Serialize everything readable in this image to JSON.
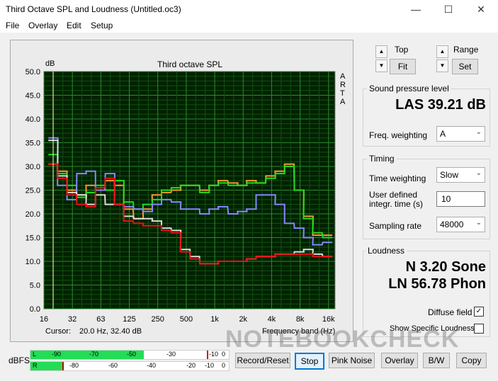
{
  "window": {
    "title": "Third Octave SPL and Loudness (Untitled.oc3)",
    "minimize": "—",
    "maximize": "☐",
    "close": "✕"
  },
  "menu": [
    "File",
    "Overlay",
    "Edit",
    "Setup"
  ],
  "plot": {
    "y_unit": "dB",
    "title": "Third octave SPL",
    "side_label": [
      "A",
      "R",
      "T",
      "A"
    ],
    "y_ticks": [
      "50.0",
      "45.0",
      "40.0",
      "35.0",
      "30.0",
      "25.0",
      "20.0",
      "15.0",
      "10.0",
      "5.0",
      "0.0"
    ],
    "x_ticks": [
      "16",
      "32",
      "63",
      "125",
      "250",
      "500",
      "1k",
      "2k",
      "4k",
      "8k",
      "16k"
    ],
    "cursor_label": "Cursor:",
    "cursor_value": "20.0 Hz, 32.40 dB",
    "x_label": "Frequency band (Hz)"
  },
  "chart_data": {
    "type": "line",
    "title": "Third octave SPL",
    "ylabel": "dB",
    "xlabel": "Frequency band (Hz)",
    "ylim": [
      0,
      50
    ],
    "x_scale": "log",
    "grid": true,
    "x": [
      20,
      25,
      31.5,
      40,
      50,
      63,
      80,
      100,
      125,
      160,
      200,
      250,
      315,
      400,
      500,
      630,
      800,
      1000,
      1250,
      1600,
      2000,
      2500,
      3150,
      4000,
      5000,
      6300,
      8000,
      10000,
      12500,
      16000
    ],
    "series": [
      {
        "color": "#ff9933",
        "values": [
          30.5,
          29,
          25,
          24,
          26,
          25,
          27,
          26,
          21,
          19,
          21,
          24,
          24.5,
          25,
          26,
          26,
          25,
          26,
          27,
          26.5,
          26,
          27,
          26.5,
          28,
          29,
          30.5,
          25,
          19.5,
          15.5,
          15.5
        ]
      },
      {
        "color": "#22dd22",
        "values": [
          32.5,
          28.5,
          26,
          23.5,
          24.5,
          26,
          25,
          27,
          22.5,
          21,
          22,
          23,
          25,
          25.5,
          26,
          26,
          24.5,
          26,
          26.5,
          26,
          26,
          26.5,
          26.5,
          27.5,
          28.5,
          30,
          25,
          19,
          16,
          15
        ]
      },
      {
        "color": "#8888ff",
        "values": [
          36,
          26,
          23,
          28.5,
          29,
          25,
          28.5,
          22,
          21.5,
          21,
          20.5,
          22,
          23,
          22.5,
          21,
          21,
          20,
          21,
          21.5,
          20,
          20.5,
          21,
          24,
          24,
          22,
          18,
          17,
          15,
          13.5,
          14
        ]
      },
      {
        "color": "#dddddd",
        "values": [
          35.5,
          28,
          24.5,
          24,
          22,
          24,
          22,
          22,
          19.5,
          19,
          19,
          18.5,
          17,
          16.5,
          12.5,
          11,
          9.5,
          9.5,
          10,
          10,
          10,
          10.5,
          11,
          11,
          11.5,
          11.5,
          12,
          12.5,
          11.5,
          11
        ]
      },
      {
        "color": "#ee1111",
        "values": [
          30.5,
          27.5,
          24,
          22,
          21.5,
          25.5,
          27.5,
          22,
          18.5,
          18,
          17.5,
          17.5,
          16.5,
          16,
          12,
          10.5,
          9.5,
          9.5,
          10,
          10,
          10,
          10.5,
          11,
          11,
          11.5,
          11.5,
          11.5,
          11.5,
          11,
          11
        ]
      }
    ]
  },
  "top": {
    "label": "Top",
    "button": "Fit",
    "up": "▲",
    "down": "▼"
  },
  "range": {
    "label": "Range",
    "button": "Set",
    "up": "▲",
    "down": "▼"
  },
  "spl": {
    "group": "Sound pressure level",
    "value": "LAS 39.21 dB",
    "weighting_label": "Freq. weighting",
    "weighting": "A"
  },
  "timing": {
    "group": "Timing",
    "time_weighting_label": "Time weighting",
    "time_weighting": "Slow",
    "user_time_label_1": "User defined",
    "user_time_label_2": "integr. time (s)",
    "user_time": "10",
    "sampling_label": "Sampling rate",
    "sampling": "48000"
  },
  "loudness": {
    "group": "Loudness",
    "sone": "N 3.20 Sone",
    "phon": "LN 56.78 Phon",
    "diffuse_label": "Diffuse field",
    "diffuse_checked": "✓",
    "specific_label": "Show Specific Loudness"
  },
  "meters": {
    "unit": "dBFS",
    "l_label": "L",
    "r_label": "R",
    "l_scale": [
      "-90",
      "-70",
      "-50",
      "-30",
      "-10",
      "0"
    ],
    "r_scale": [
      "-80",
      "-60",
      "-40",
      "-20",
      "-10",
      "0"
    ],
    "l_level": 0.57,
    "r_level": 0.16,
    "l_peak": 0.89,
    "r_peak": 0.16
  },
  "buttons": [
    "Record/Reset",
    "Stop",
    "Pink Noise",
    "Overlay",
    "B/W",
    "Copy"
  ],
  "watermark": "NOTEBOOKCHECK"
}
